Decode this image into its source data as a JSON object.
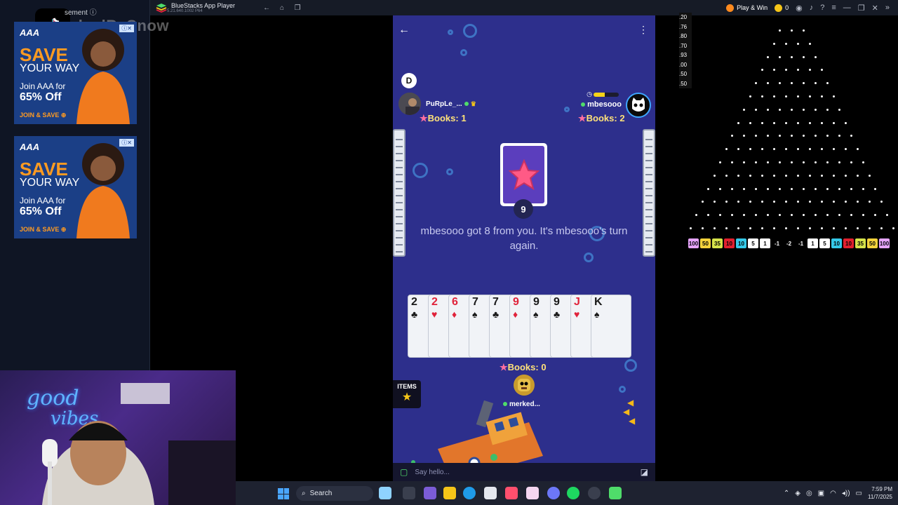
{
  "left_panel": {
    "ad_label": "sement ⓘ",
    "watermark": "erkedBySnow",
    "ads": [
      {
        "brand": "AAA",
        "save": "SAVE",
        "your_way": "YOUR WAY",
        "join": "Join AAA for",
        "pct": "65% Off",
        "cta": "JOIN & SAVE ⊕"
      },
      {
        "brand": "AAA",
        "save": "SAVE",
        "your_way": "YOUR WAY",
        "join": "Join AAA for",
        "pct": "65% Off",
        "cta": "JOIN & SAVE ⊕"
      }
    ]
  },
  "topbar": {
    "title": "BlueStacks App Player",
    "subtitle": "5.21.640.1002 P64",
    "play_win": "Play & Win",
    "coins": "0"
  },
  "game": {
    "dealer_badge": "D",
    "opponent_left": {
      "name": "PuRpLe_...",
      "books": "Books: 1"
    },
    "opponent_right": {
      "name": "mbesooo",
      "books": "Books: 2"
    },
    "timer_fill": 0.45,
    "pile_count": "9",
    "message": "mbesooo got 8 from you. It's mbesooo's turn again.",
    "hand": [
      {
        "rank": "2",
        "suit": "♣",
        "color": "black"
      },
      {
        "rank": "2",
        "suit": "♥",
        "color": "red"
      },
      {
        "rank": "6",
        "suit": "♦",
        "color": "red"
      },
      {
        "rank": "7",
        "suit": "♠",
        "color": "black"
      },
      {
        "rank": "7",
        "suit": "♣",
        "color": "black"
      },
      {
        "rank": "9",
        "suit": "♦",
        "color": "red"
      },
      {
        "rank": "9",
        "suit": "♠",
        "color": "black"
      },
      {
        "rank": "9",
        "suit": "♣",
        "color": "black"
      },
      {
        "rank": "J",
        "suit": "♥",
        "color": "red"
      },
      {
        "rank": "K",
        "suit": "♠",
        "color": "black"
      }
    ],
    "my_books": "Books: 0",
    "my_name": "merked...",
    "items_label": "ITEMS",
    "chat_placeholder": "Say hello..."
  },
  "plinko": {
    "odds": [
      ".20",
      ".76",
      ".80",
      ".70",
      ".93",
      ".00",
      ".50",
      ".50"
    ],
    "slots": [
      {
        "label": "100",
        "color": "#e6a5ff"
      },
      {
        "label": "50",
        "color": "#f3d23b"
      },
      {
        "label": "35",
        "color": "#d6e34a"
      },
      {
        "label": "10",
        "color": "#e0202e"
      },
      {
        "label": "10",
        "color": "#35c9e8"
      },
      {
        "label": "5",
        "color": "#ffffff"
      },
      {
        "label": "1",
        "color": "#ffffff"
      },
      {
        "label": "-1",
        "color": "#000000"
      },
      {
        "label": "-2",
        "color": "#000000"
      },
      {
        "label": "-1",
        "color": "#000000"
      },
      {
        "label": "1",
        "color": "#ffffff"
      },
      {
        "label": "5",
        "color": "#ffffff"
      },
      {
        "label": "10",
        "color": "#35c9e8"
      },
      {
        "label": "10",
        "color": "#e0202e"
      },
      {
        "label": "35",
        "color": "#d6e34a"
      },
      {
        "label": "50",
        "color": "#f3d23b"
      },
      {
        "label": "100",
        "color": "#e6a5ff"
      }
    ]
  },
  "webcam": {
    "neon_1": "good",
    "neon_2": "vibes"
  },
  "taskbar": {
    "search": "Search",
    "time": "7:59 PM",
    "date": "11/7/2025"
  }
}
